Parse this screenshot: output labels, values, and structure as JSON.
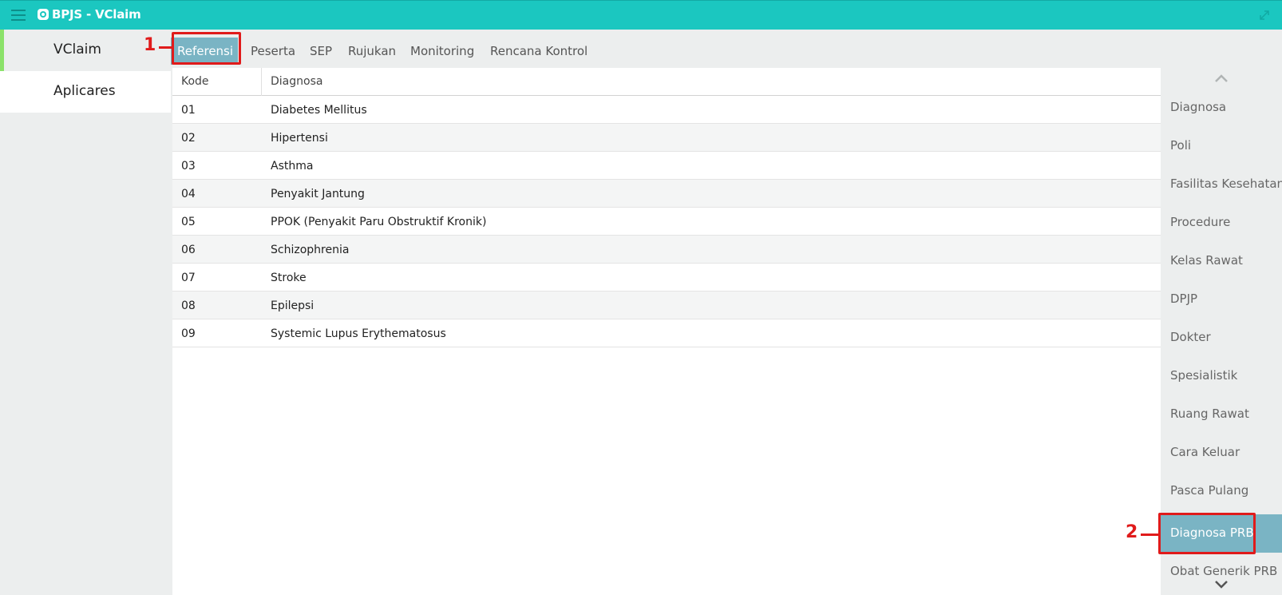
{
  "header": {
    "title": "BPJS - VClaim",
    "icons": [
      "menu-icon",
      "gear-icon",
      "expand-icon"
    ],
    "color": "#1bc7c0"
  },
  "sidebar": {
    "items": [
      {
        "label": "VClaim",
        "active": true
      },
      {
        "label": "Aplicares",
        "active": false
      }
    ],
    "accent": "#8be26a"
  },
  "tabs": [
    {
      "label": "Referensi",
      "active": true
    },
    {
      "label": "Peserta"
    },
    {
      "label": "SEP"
    },
    {
      "label": "Rujukan"
    },
    {
      "label": "Monitoring"
    },
    {
      "label": "Rencana Kontrol"
    }
  ],
  "table": {
    "columns": [
      "Kode",
      "Diagnosa"
    ],
    "rows": [
      [
        "01",
        "Diabetes Mellitus"
      ],
      [
        "02",
        "Hipertensi"
      ],
      [
        "03",
        "Asthma"
      ],
      [
        "04",
        "Penyakit Jantung"
      ],
      [
        "05",
        "PPOK (Penyakit Paru Obstruktif Kronik)"
      ],
      [
        "06",
        "Schizophrenia"
      ],
      [
        "07",
        "Stroke"
      ],
      [
        "08",
        "Epilepsi"
      ],
      [
        "09",
        "Systemic Lupus Erythematosus"
      ]
    ]
  },
  "rightnav": {
    "items": [
      "Diagnosa",
      "Poli",
      "Fasilitas Kesehatan",
      "Procedure",
      "Kelas Rawat",
      "DPJP",
      "Dokter",
      "Spesialistik",
      "Ruang Rawat",
      "Cara Keluar",
      "Pasca Pulang",
      "Diagnosa PRB",
      "Obat Generik PRB"
    ],
    "active": "Diagnosa PRB",
    "icons": [
      "chevron-up-icon",
      "chevron-down-icon"
    ]
  },
  "annotations": {
    "one": "1",
    "two": "2",
    "color": "#e01b1b"
  },
  "colors": {
    "active_tab": "#7ab4c4"
  }
}
